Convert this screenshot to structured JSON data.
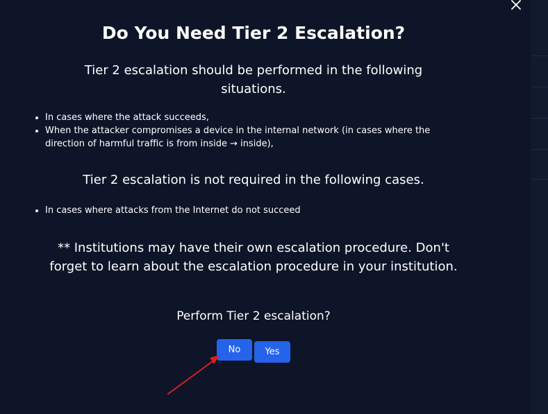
{
  "dialog": {
    "title": "Do You Need Tier 2 Escalation?",
    "lead": "Tier 2 escalation should be performed in the following situations.",
    "situations": [
      "In cases where the attack succeeds,",
      "When the attacker compromises a device in the internal network (in cases where the direction of harmful traffic is from inside → inside),"
    ],
    "not_required_heading": "Tier 2 escalation is not required in the following cases.",
    "not_required": [
      "In cases where attacks from the Internet do not succeed"
    ],
    "note": "** Institutions may have their own escalation procedure. Don't forget to learn about the escalation procedure in your institution.",
    "prompt": "Perform Tier 2 escalation?",
    "buttons": {
      "no": "No",
      "yes": "Yes"
    },
    "close_icon": "close-icon"
  },
  "annotation": {
    "arrow_icon": "red-arrow",
    "arrow_color": "#e11d1d"
  },
  "colors": {
    "background": "#0e1528",
    "button": "#2563eb",
    "text": "#ffffff"
  }
}
